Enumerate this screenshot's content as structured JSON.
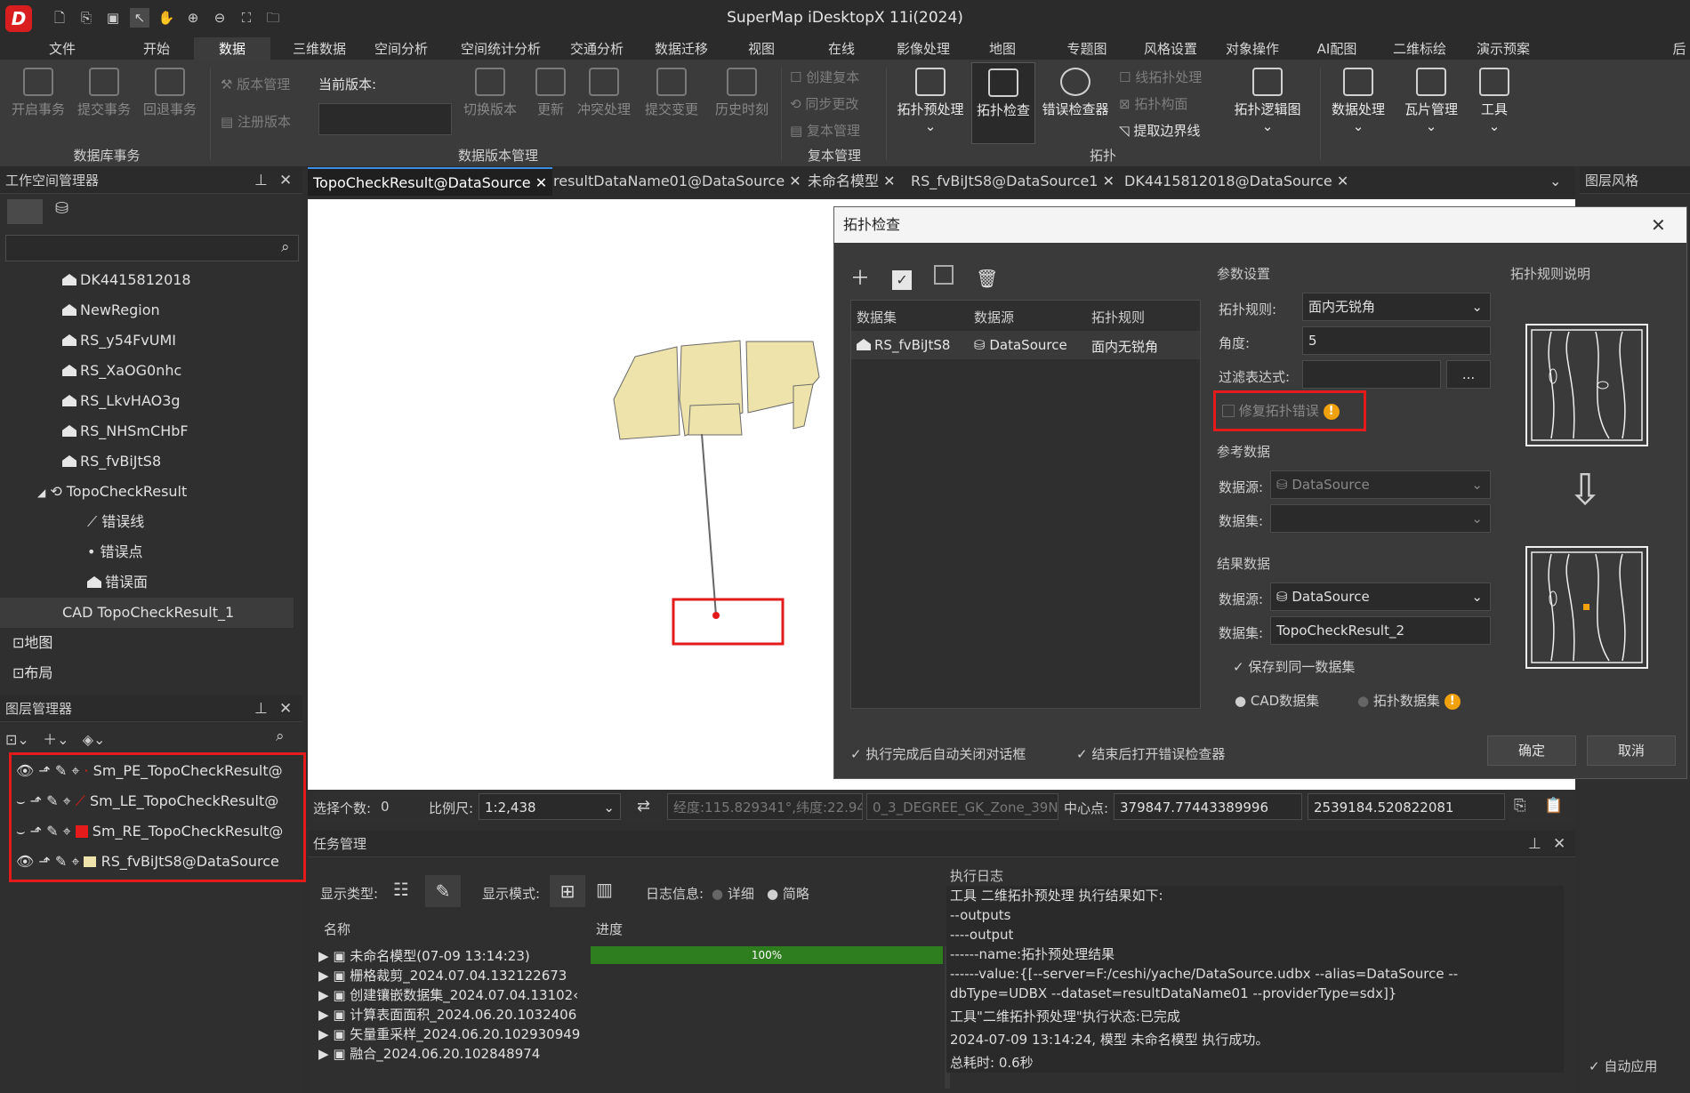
{
  "app": {
    "title": "SuperMap iDesktopX 11i(2024)",
    "logo": "D"
  },
  "menu": [
    "文件",
    "开始",
    "数据",
    "三维数据",
    "空间分析",
    "空间统计分析",
    "交通分析",
    "数据迁移",
    "视图",
    "在线",
    "影像处理",
    "地图",
    "专题图",
    "风格设置",
    "对象操作",
    "AI配图",
    "二维标绘",
    "演示预案"
  ],
  "menu_more": "后",
  "ribbon": {
    "db_tx": {
      "btns": [
        "开启事务",
        "提交事务",
        "回退事务"
      ],
      "group": "数据库事务"
    },
    "version": {
      "manage": "版本管理",
      "current_label": "当前版本:",
      "register": "注册版本",
      "btns": [
        "切换版本",
        "更新",
        "冲突处理",
        "提交变更",
        "历史时刻"
      ],
      "group": "数据版本管理"
    },
    "replica": {
      "items": [
        "创建复本",
        "同步更改",
        "复本管理"
      ],
      "group": "复本管理"
    },
    "topo": {
      "btns": [
        "拓扑预处理",
        "拓扑检查",
        "错误检查器"
      ],
      "small": [
        "线拓扑处理",
        "拓扑构面",
        "提取边界线"
      ],
      "logic": "拓扑逻辑图",
      "group": "拓扑"
    },
    "data_proc": "数据处理",
    "tile": "瓦片管理",
    "tools": "工具"
  },
  "workspace": {
    "title": "工作空间管理器",
    "items": [
      {
        "label": "DK4415812018",
        "indent": 2
      },
      {
        "label": "NewRegion",
        "indent": 2
      },
      {
        "label": "RS_y54FvUMI",
        "indent": 2
      },
      {
        "label": "RS_XaOG0nhc",
        "indent": 2
      },
      {
        "label": "RS_LkvHAO3g",
        "indent": 2
      },
      {
        "label": "RS_NHSmCHbF",
        "indent": 2
      },
      {
        "label": "RS_fvBiJtS8",
        "indent": 2
      },
      {
        "label": "TopoCheckResult",
        "indent": 1
      },
      {
        "label": "错误线",
        "indent": 3
      },
      {
        "label": "错误点",
        "indent": 3
      },
      {
        "label": "错误面",
        "indent": 3
      },
      {
        "label": "CAD TopoCheckResult_1",
        "indent": 2
      },
      {
        "label": "地图",
        "indent": 0
      },
      {
        "label": "布局",
        "indent": 0
      }
    ]
  },
  "layers": {
    "title": "图层管理器",
    "items": [
      "Sm_PE_TopoCheckResult@",
      "Sm_LE_TopoCheckResult@",
      "Sm_RE_TopoCheckResult@",
      "RS_fvBiJtS8@DataSource"
    ]
  },
  "tabs": [
    "TopoCheckResult@DataSource",
    "resultDataName01@DataSource",
    "未命名模型",
    "RS_fvBiJtS8@DataSource1",
    "DK4415812018@DataSource"
  ],
  "right_panel": {
    "title": "图层风格",
    "auto_apply": "自动应用"
  },
  "dialog": {
    "title": "拓扑检查",
    "table_headers": [
      "数据集",
      "数据源",
      "拓扑规则"
    ],
    "row": [
      "RS_fvBiJtS8",
      "DataSource",
      "面内无锐角"
    ],
    "params_title": "参数设置",
    "rule_label": "拓扑规则:",
    "rule_value": "面内无锐角",
    "angle_label": "角度:",
    "angle_value": "5",
    "filter_label": "过滤表达式:",
    "filter_btn": "...",
    "repair_label": "修复拓扑错误",
    "ref_title": "参考数据",
    "ref_ds_label": "数据源:",
    "ref_ds_value": "DataSource",
    "ref_set_label": "数据集:",
    "result_title": "结果数据",
    "res_ds_label": "数据源:",
    "res_ds_value": "DataSource",
    "res_set_label": "数据集:",
    "res_set_value": "TopoCheckResult_2",
    "save_same": "保存到同一数据集",
    "cad_opt": "CAD数据集",
    "topo_opt": "拓扑数据集",
    "rule_desc": "拓扑规则说明",
    "auto_close": "执行完成后自动关闭对话框",
    "open_checker": "结束后打开错误检查器",
    "ok": "确定",
    "cancel": "取消"
  },
  "status": {
    "sel_label": "选择个数:",
    "sel_value": "0",
    "scale_label": "比例尺:",
    "scale_value": "1:2,438",
    "coord": "经度:115.829341°,纬度:22.94",
    "proj": "0_3_DEGREE_GK_Zone_39N",
    "center_label": "中心点:",
    "cx": "379847.77443389996",
    "cy": "2539184.520822081"
  },
  "task": {
    "title": "任务管理",
    "type_label": "显示类型:",
    "mode_label": "显示模式:",
    "log_label": "日志信息:",
    "detail": "详细",
    "brief": "简略",
    "cols": [
      "名称",
      "进度"
    ],
    "rows": [
      {
        "name": "未命名模型(07-09 13:14:23)",
        "progress": "100%"
      },
      {
        "name": "栅格裁剪_2024.07.04.132122673",
        "progress": ""
      },
      {
        "name": "创建镶嵌数据集_2024.07.04.13102‹",
        "progress": ""
      },
      {
        "name": "计算表面面积_2024.06.20.1032406",
        "progress": ""
      },
      {
        "name": "矢量重采样_2024.06.20.102930949",
        "progress": ""
      },
      {
        "name": "融合_2024.06.20.102848974",
        "progress": ""
      }
    ],
    "log_title": "执行日志",
    "log": [
      "工具 二维拓扑预处理 执行结果如下:",
      "--outputs",
      "----output",
      "------name:拓扑预处理结果",
      "------value:{[--server=F:/ceshi/yache/DataSource.udbx --alias=DataSource --",
      "dbType=UDBX --dataset=resultDataName01 --providerType=sdx]}",
      "工具\"二维拓扑预处理\"执行状态:已完成",
      "2024-07-09 13:14:24, 模型 未命名模型 执行成功。",
      "总耗时: 0.6秒"
    ]
  },
  "colors": {
    "accent": "#3a8ee6",
    "highlight": "#e31b1b",
    "polygon": "#ede3ab",
    "progress": "#2e7d1e"
  }
}
